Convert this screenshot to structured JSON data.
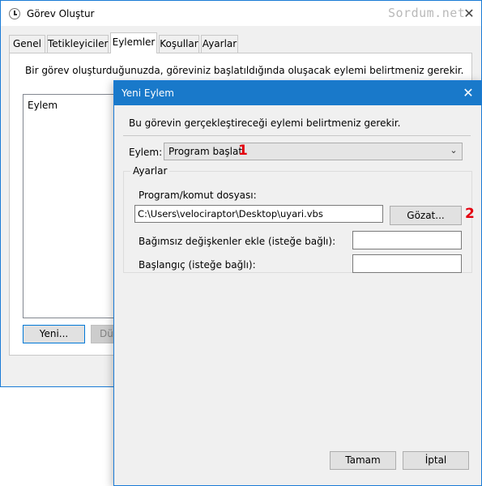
{
  "back_window": {
    "title": "Görev Oluştur",
    "watermark": "Sordum.net",
    "close_glyph": "✕",
    "tabs": [
      "Genel",
      "Tetikleyiciler",
      "Eylemler",
      "Koşullar",
      "Ayarlar"
    ],
    "active_tab": "Eylemler",
    "instruction": "Bir görev oluşturduğunuzda, göreviniz başlatıldığında oluşacak eylemi belirtmeniz gerekir.",
    "list_header": "Eylem",
    "new_button": "Yeni...",
    "edit_button": "Düzenle..."
  },
  "dialog": {
    "title": "Yeni Eylem",
    "close_glyph": "✕",
    "instruction": "Bu görevin gerçekleştireceği eylemi belirtmeniz gerekir.",
    "action_label": "Eylem:",
    "action_value": "Program başlat",
    "marker_1": "1",
    "settings_label": "Ayarlar",
    "program_label": "Program/komut dosyası:",
    "program_value": "C:\\Users\\velociraptor\\Desktop\\uyari.vbs",
    "browse_button": "Gözat...",
    "marker_2": "2",
    "args_label": "Bağımsız değişkenler ekle (isteğe bağlı):",
    "args_value": "",
    "start_label": "Başlangıç (isteğe bağlı):",
    "start_value": "",
    "ok_button": "Tamam",
    "cancel_button": "İptal"
  },
  "colors": {
    "accent_titlebar": "#1979ca",
    "marker_red": "#e3000f"
  },
  "icons": {
    "window_icon": "clock-icon",
    "dropdown": "chevron-down-icon"
  }
}
